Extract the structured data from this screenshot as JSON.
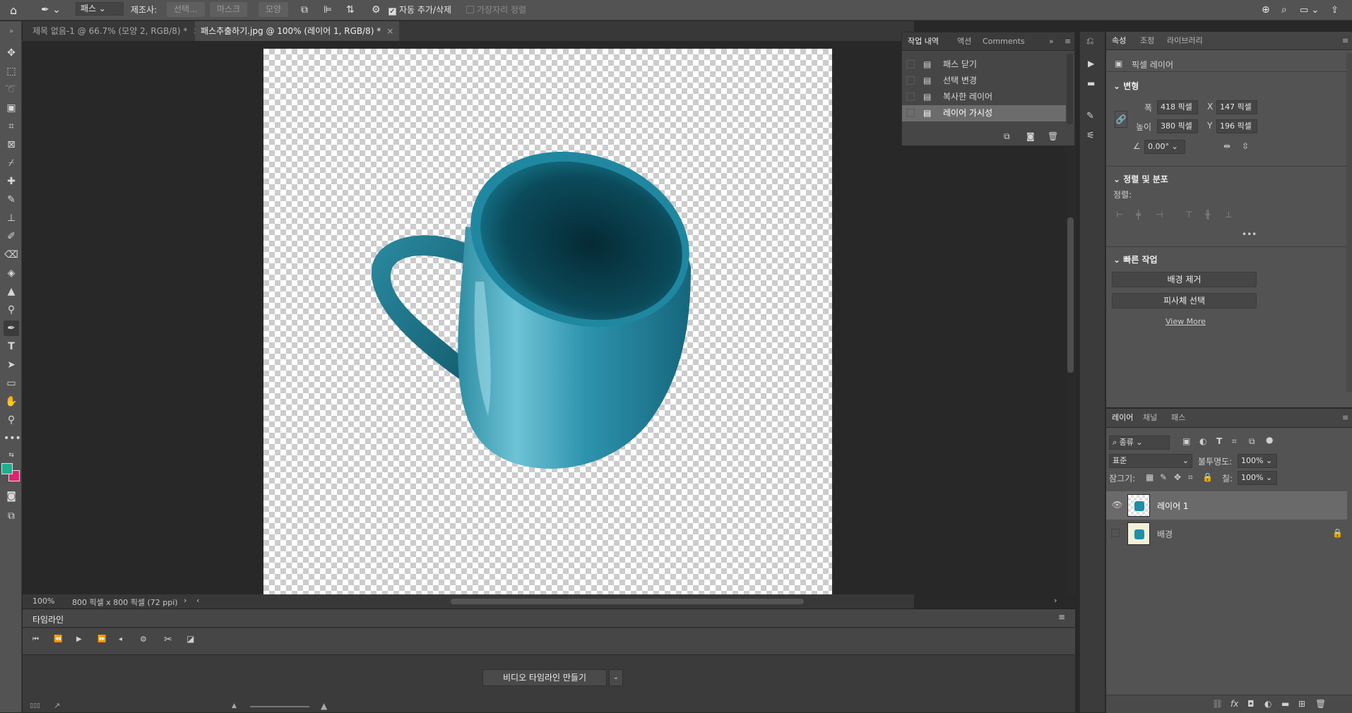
{
  "options_bar": {
    "tool_mode": "패스",
    "make_label": "제조사:",
    "btn_selection": "선택...",
    "btn_mask": "마스크",
    "btn_shape": "모양",
    "auto_add_delete": "자동 추가/삭제",
    "align_edges": "가장자리 정렬"
  },
  "doc_tabs": [
    {
      "label": "제목 없음-1 @ 66.7% (모양 2, RGB/8) *"
    },
    {
      "label": "패스추출하기.jpg @ 100% (레이어 1, RGB/8) *"
    }
  ],
  "status": {
    "zoom": "100%",
    "doc_size": "800 픽셀 x 800 픽셀 (72 ppi)"
  },
  "timeline": {
    "title": "타임라인",
    "create_button": "비디오 타임라인 만들기"
  },
  "history_panel": {
    "tabs": [
      "작업 내역",
      "액션",
      "Comments"
    ],
    "items": [
      "패스 닫기",
      "선택 변경",
      "복사한 레이어",
      "레이어 가시성"
    ]
  },
  "properties": {
    "tabs": [
      "속성",
      "조정",
      "라이브러리"
    ],
    "layer_type": "픽셀 레이어",
    "transform_title": "변형",
    "width_label": "폭",
    "width_value": "418 픽셀",
    "x_label": "X",
    "x_value": "147 픽셀",
    "height_label": "높이",
    "height_value": "380 픽셀",
    "y_label": "Y",
    "y_value": "196 픽셀",
    "angle_value": "0.00°",
    "align_title": "정렬 및 분포",
    "align_label": "정렬:",
    "quick_title": "빠른 작업",
    "remove_bg": "배경 제거",
    "select_subject": "피사체 선택",
    "view_more": "View More"
  },
  "layers_panel": {
    "tabs": [
      "레이어",
      "채널",
      "패스"
    ],
    "filter_kind": "종류",
    "blend_mode": "표준",
    "opacity_label": "불투명도:",
    "opacity_value": "100%",
    "lock_label": "잠그기:",
    "fill_label": "칠:",
    "fill_value": "100%",
    "layers": [
      {
        "name": "레이어 1",
        "visible": true,
        "selected": true
      },
      {
        "name": "배경",
        "visible": false,
        "locked": true
      }
    ]
  },
  "colors": {
    "foreground": "#1fae8f",
    "background": "#e0246f",
    "mug": "#1e8fa6"
  }
}
